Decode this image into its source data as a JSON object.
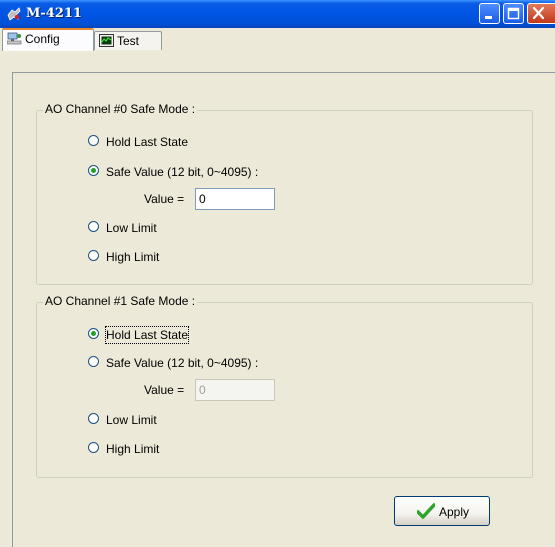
{
  "window": {
    "title": "M-4211"
  },
  "tabs": [
    {
      "label": "Config",
      "icon": "network-computer-icon",
      "active": true
    },
    {
      "label": "Test",
      "icon": "monitor-graph-icon",
      "active": false
    }
  ],
  "channel0": {
    "title": "AO Channel #0 Safe Mode :",
    "options": [
      {
        "label": "Hold Last State",
        "checked": false
      },
      {
        "label": "Safe Value (12 bit, 0~4095) :",
        "checked": true
      },
      {
        "label": "Low Limit",
        "checked": false
      },
      {
        "label": "High Limit",
        "checked": false
      }
    ],
    "value_label": "Value =",
    "value": "0",
    "value_enabled": true
  },
  "channel1": {
    "title": "AO Channel #1 Safe Mode :",
    "options": [
      {
        "label": "Hold Last State",
        "checked": true
      },
      {
        "label": "Safe Value (12 bit, 0~4095) :",
        "checked": false
      },
      {
        "label": "Low Limit",
        "checked": false
      },
      {
        "label": "High Limit",
        "checked": false
      }
    ],
    "value_label": "Value =",
    "value": "0",
    "value_enabled": false
  },
  "apply": {
    "label": "Apply",
    "icon": "checkmark-icon"
  },
  "colors": {
    "titlebar": "#0054e3",
    "active_tab_accent": "#e68b2c",
    "radio_dot": "#21a121",
    "check_green": "#2ea42e"
  }
}
